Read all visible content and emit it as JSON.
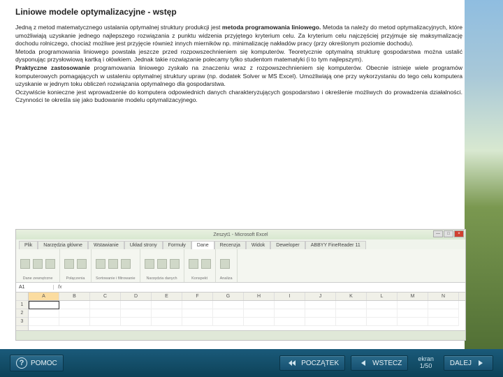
{
  "page": {
    "title": "Liniowe modele optymalizacyjne - wstęp",
    "p1a": "Jedną z metod matematycznego ustalania optymalnej struktury produkcji jest ",
    "p1b": "metoda programowania liniowego.",
    "p1c": "  Metoda ta należy do metod optymalizacyjnych, które umożliwiają uzyskanie jednego najlepszego rozwiązania z punktu widzenia przyjętego kryterium celu. Za kryterium celu najczęściej przyjmuje się maksymalizację dochodu rolniczego, chociaż możliwe jest przyjęcie również innych mierników np. minimalizację nakładów pracy (przy określonym poziomie dochodu).",
    "p2": "Metoda programowania liniowego powstała jeszcze przed rozpowszechnieniem się komputerów. Teoretycznie optymalną strukturę gospodarstwa można ustalić dysponując przysłowiową kartką i ołówkiem. Jednak takie rozwiązanie polecamy tylko studentom matematyki (i to tym najlepszym).",
    "p3a": "Praktyczne zastosowanie",
    "p3b": " programowania liniowego zyskało na znaczeniu wraz z rozpowszechnieniem się komputerów. Obecnie istnieje wiele programów komputerowych pomagających w ustaleniu optymalnej struktury upraw (np. dodatek Solver w MS Excel). Umożliwiają one przy wykorzystaniu do tego celu komputera uzyskanie w jednym toku obliczeń rozwiązania optymalnego dla gospodarstwa.",
    "p4": "Oczywiście konieczne jest wprowadzenie do komputera odpowiednich danych charakteryzujących gospodarstwo i określenie możliwych do prowadzenia działalności. Czynności te określa się jako budowanie modelu optymalizacyjnego."
  },
  "excel": {
    "title": "Zeszyt1 - Microsoft Excel",
    "tabs": [
      "Plik",
      "Narzędzia główne",
      "Wstawianie",
      "Układ strony",
      "Formuły",
      "Dane",
      "Recenzja",
      "Widok",
      "Deweloper",
      "ABBYY FineReader 11"
    ],
    "activeTab": "Dane",
    "groups": [
      "Dane zewnętrzne",
      "Połączenia",
      "Sortowanie i filtrowanie",
      "Narzędzia danych",
      "Konspekt",
      "Analiza"
    ],
    "namebox": "A1",
    "fx": "fx",
    "cols": [
      "A",
      "B",
      "C",
      "D",
      "E",
      "F",
      "G",
      "H",
      "I",
      "J",
      "K",
      "L",
      "M",
      "N"
    ],
    "rows": [
      "1",
      "2",
      "3"
    ]
  },
  "footer": {
    "pomoc": "POMOC",
    "poczatek": "POCZĄTEK",
    "wstecz": "WSTECZ",
    "dalej": "DALEJ",
    "page_label": "ekran",
    "page_num": "1/50"
  }
}
